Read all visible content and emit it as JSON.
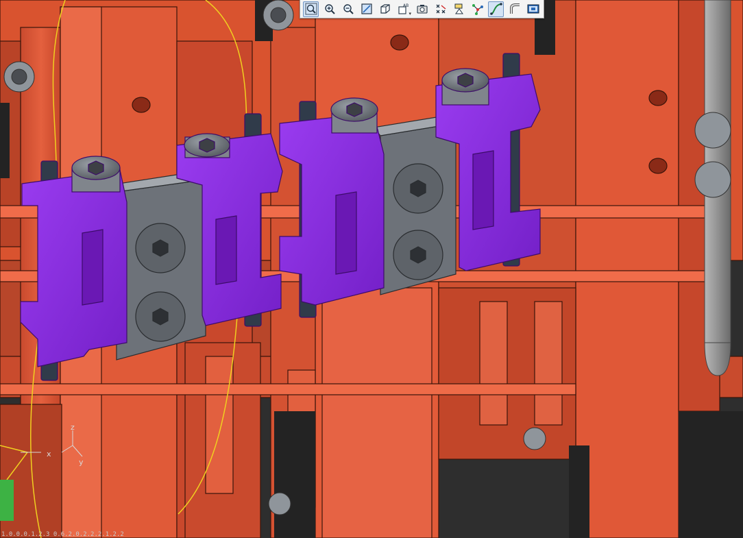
{
  "toolbar": {
    "buttons": [
      {
        "name": "zoom-box-button",
        "icon": "zoom-box-icon",
        "active": true
      },
      {
        "name": "zoom-in-button",
        "icon": "zoom-in-icon"
      },
      {
        "name": "zoom-out-button",
        "icon": "zoom-out-icon"
      },
      {
        "name": "zoom-fit-button",
        "icon": "zoom-fit-icon"
      },
      {
        "name": "view-cube-button",
        "icon": "view-cube-icon"
      },
      {
        "name": "named-views-button",
        "icon": "named-views-icon",
        "label": "AB"
      },
      {
        "name": "snapshot-button",
        "icon": "camera-icon"
      },
      {
        "name": "snap-points-button",
        "icon": "snap-points-icon"
      },
      {
        "name": "section-button",
        "icon": "section-icon"
      },
      {
        "name": "node-path-button",
        "icon": "node-path-icon"
      },
      {
        "name": "curve-button",
        "icon": "curve-icon",
        "active": true
      },
      {
        "name": "pipe-button",
        "icon": "pipe-icon"
      },
      {
        "name": "model-window-button",
        "icon": "model-window-icon"
      }
    ]
  },
  "axis_triad": {
    "x": "x",
    "y": "y",
    "z": "z"
  },
  "status": {
    "coordinates": "1.0.0.0.1.2.3 0.6.2.0.2.2.2.1.2.2"
  },
  "colors": {
    "part_orange": "#e25a3a",
    "clamp_purple": "#8b2be2",
    "block_gray": "#6d7279",
    "background": "#2b2b2b",
    "wire_yellow": "#f0d020"
  }
}
